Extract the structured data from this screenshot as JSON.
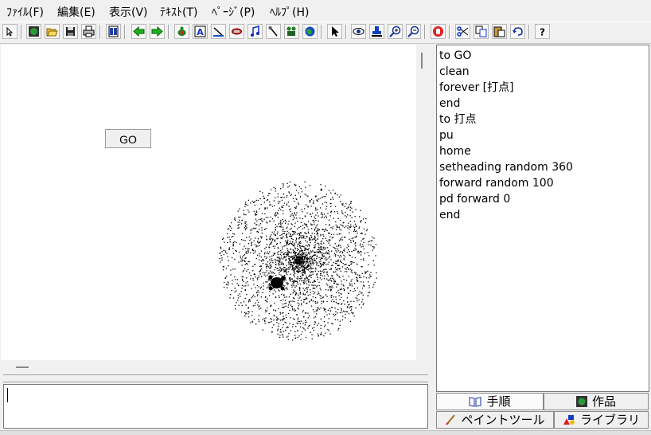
{
  "menu": [
    "ﾌｧｲﾙ(F)",
    "編集(E)",
    "表示(V)",
    "ﾃｷｽﾄ(T)",
    "ﾍﾟｰｼﾞ(P)",
    "ﾍﾙﾌﾟ(H)"
  ],
  "toolbar": {
    "help_label": "?"
  },
  "canvas": {
    "go_button_label": "GO"
  },
  "procedures": [
    "to GO",
    "clean",
    "forever [打点]",
    "end",
    "to 打点",
    "pu",
    "home",
    "setheading random 360",
    "forward random 100",
    "pd forward 0",
    "end"
  ],
  "tabs": {
    "procedures": "手順",
    "project": "作品",
    "paint": "ペイントツール",
    "library": "ライブラリ"
  },
  "colors": {
    "background": "#f0f0f0",
    "canvas": "#ffffff",
    "dots": "#000000"
  }
}
